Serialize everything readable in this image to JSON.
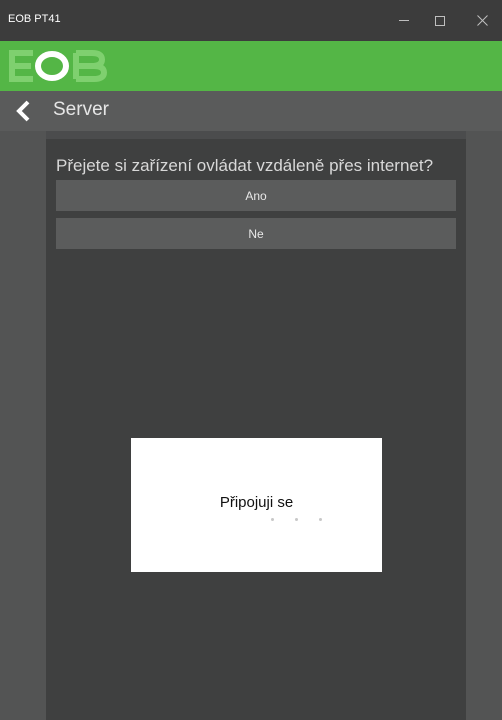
{
  "window": {
    "title": "EOB PT41",
    "minimize_icon": "minimize-icon",
    "maximize_icon": "maximize-icon",
    "close_icon": "close-icon"
  },
  "brand": {
    "logo_text": "EOB",
    "color": "#54b646"
  },
  "nav": {
    "back_icon": "chevron-left-icon",
    "title": "Server"
  },
  "content": {
    "question": "Přejete si zařízení ovládat vzdáleně přes internet?",
    "yes_label": "Ano",
    "no_label": "Ne"
  },
  "dialog": {
    "text": "Připojuji se",
    "progress_icon": "loading-dots-icon"
  }
}
